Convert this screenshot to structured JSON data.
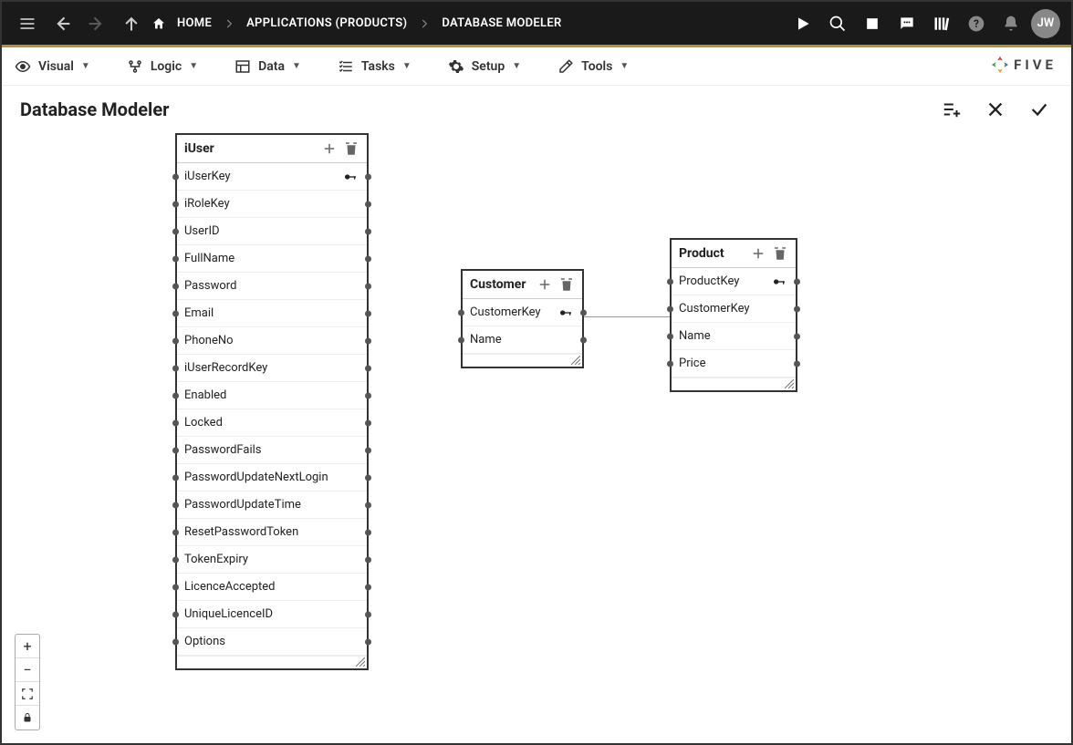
{
  "topbar": {
    "home": "HOME",
    "crumb1": "APPLICATIONS (PRODUCTS)",
    "crumb2": "DATABASE MODELER",
    "avatar": "JW"
  },
  "menu": {
    "visual": "Visual",
    "logic": "Logic",
    "data": "Data",
    "tasks": "Tasks",
    "setup": "Setup",
    "tools": "Tools",
    "brand": "FIVE"
  },
  "page": {
    "title": "Database Modeler"
  },
  "tables": {
    "iuser": {
      "name": "iUser",
      "fields": {
        "f0": "iUserKey",
        "f1": "iRoleKey",
        "f2": "UserID",
        "f3": "FullName",
        "f4": "Password",
        "f5": "Email",
        "f6": "PhoneNo",
        "f7": "iUserRecordKey",
        "f8": "Enabled",
        "f9": "Locked",
        "f10": "PasswordFails",
        "f11": "PasswordUpdateNextLogin",
        "f12": "PasswordUpdateTime",
        "f13": "ResetPasswordToken",
        "f14": "TokenExpiry",
        "f15": "LicenceAccepted",
        "f16": "UniqueLicenceID",
        "f17": "Options"
      }
    },
    "customer": {
      "name": "Customer",
      "fields": {
        "f0": "CustomerKey",
        "f1": "Name"
      }
    },
    "product": {
      "name": "Product",
      "fields": {
        "f0": "ProductKey",
        "f1": "CustomerKey",
        "f2": "Name",
        "f3": "Price"
      }
    }
  }
}
